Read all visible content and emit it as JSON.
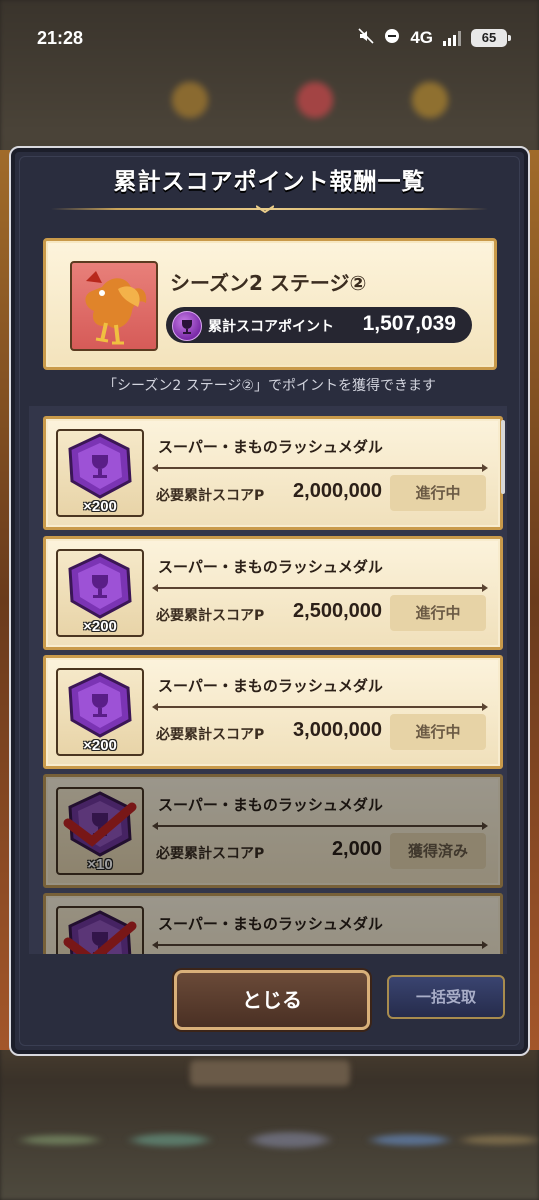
{
  "status_bar": {
    "time": "21:28",
    "network": "4G",
    "battery": "65"
  },
  "dialog": {
    "title": "累計スコアポイント報酬一覧",
    "stage": {
      "name": "シーズン2 ステージ②",
      "points_label": "累計スコアポイント",
      "points_value": "1,507,039"
    },
    "subtitle": "「シーズン2 ステージ②」でポイントを獲得できます",
    "rewards": [
      {
        "name": "スーパー・まものラッシュメダル",
        "count": "×200",
        "req_label": "必要累計スコアP",
        "req_value": "2,000,000",
        "status": "進行中",
        "claimed": false
      },
      {
        "name": "スーパー・まものラッシュメダル",
        "count": "×200",
        "req_label": "必要累計スコアP",
        "req_value": "2,500,000",
        "status": "進行中",
        "claimed": false
      },
      {
        "name": "スーパー・まものラッシュメダル",
        "count": "×200",
        "req_label": "必要累計スコアP",
        "req_value": "3,000,000",
        "status": "進行中",
        "claimed": false
      },
      {
        "name": "スーパー・まものラッシュメダル",
        "count": "×10",
        "req_label": "必要累計スコアP",
        "req_value": "2,000",
        "status": "獲得済み",
        "claimed": true
      },
      {
        "name": "スーパー・まものラッシュメダル",
        "count": "",
        "req_label": "",
        "req_value": "",
        "status": "",
        "claimed": true
      }
    ],
    "close_button": "とじる",
    "bulk_button": "一括受取"
  },
  "colors": {
    "dialog_bg": "#2a2d3e",
    "card_bg": "#fcf3dc",
    "card_border": "#c99a4a",
    "medal_purple": "#8a3fc0",
    "check_red": "#d92020"
  }
}
